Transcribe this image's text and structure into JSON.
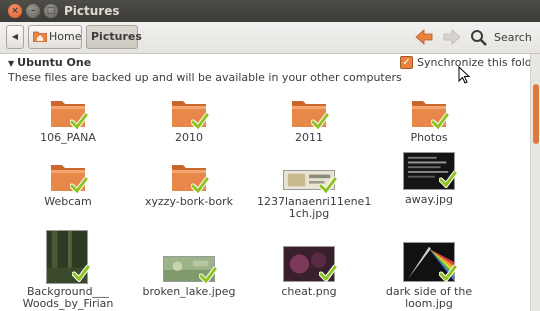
{
  "window": {
    "title": "Pictures"
  },
  "toolbar": {
    "home_label": "Home",
    "pictures_label": "Pictures",
    "search_label": "Search"
  },
  "section": {
    "name": "Ubuntu One",
    "description": "These files are backed up and will be available in your other computers",
    "sync_label": "Synchronize this folder",
    "sync_checked": true
  },
  "files": [
    {
      "name": "106_PANA",
      "type": "folder"
    },
    {
      "name": "2010",
      "type": "folder"
    },
    {
      "name": "2011",
      "type": "folder"
    },
    {
      "name": "Photos",
      "type": "folder"
    },
    {
      "name": "Webcam",
      "type": "folder"
    },
    {
      "name": "xyzzy-bork-bork",
      "type": "folder"
    },
    {
      "name": "1237lanaenri11ene11ch.jpg",
      "name_line1": "1237lanaenri11ene1",
      "name_line2": "1ch.jpg",
      "type": "image"
    },
    {
      "name": "away.jpg",
      "type": "image"
    },
    {
      "name": "Background___Woods_by_Firian",
      "name_line1": "Background___",
      "name_line2": "Woods_by_Firian",
      "type": "image"
    },
    {
      "name": "broken_lake.jpeg",
      "type": "image"
    },
    {
      "name": "cheat.png",
      "type": "image"
    },
    {
      "name": "dark side of the loom.jpg",
      "name_line1": "dark side of the",
      "name_line2": "loom.jpg",
      "type": "image"
    }
  ],
  "colors": {
    "accent": "#e07a3c",
    "folder": "#e8874a",
    "check": "#8fc31f",
    "titlebar": "#3c3b37"
  }
}
